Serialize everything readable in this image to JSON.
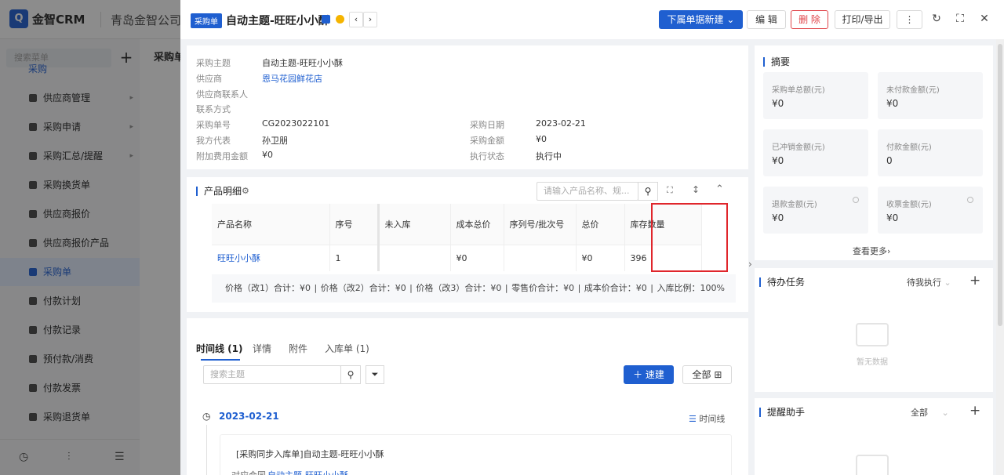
{
  "app": {
    "brand": "金智CRM",
    "company": "青岛金智公司",
    "logo_letter": "Q",
    "accent": "#1f5fd0"
  },
  "sidebar": {
    "search_placeholder": "搜索菜单",
    "add_icon": "+",
    "group_label": "采购",
    "items": [
      {
        "label": "供应商管理",
        "icon": "folder-icon",
        "has_arrow": true
      },
      {
        "label": "采购申请",
        "icon": "folder-icon",
        "has_arrow": true
      },
      {
        "label": "采购汇总/提醒",
        "icon": "folder-icon",
        "has_arrow": true
      },
      {
        "label": "采购换货单",
        "icon": "doc-icon"
      },
      {
        "label": "供应商报价",
        "icon": "doc-icon"
      },
      {
        "label": "供应商报价产品",
        "icon": "doc-icon"
      },
      {
        "label": "采购单",
        "icon": "cart-icon",
        "active": true
      },
      {
        "label": "付款计划",
        "icon": "plan-icon"
      },
      {
        "label": "付款记录",
        "icon": "record-icon"
      },
      {
        "label": "预付款/消费",
        "icon": "wallet-icon"
      },
      {
        "label": "付款发票",
        "icon": "invoice-icon"
      },
      {
        "label": "采购退货单",
        "icon": "return-icon"
      }
    ]
  },
  "background_page": {
    "title": "采购单"
  },
  "drawer": {
    "tag": "采购单",
    "title": "自动主题-旺旺小小酥",
    "buttons": {
      "new_sub": "下属单据新建",
      "edit": "编 辑",
      "delete": "删 除",
      "print": "打印/导出",
      "more": "⋮"
    },
    "info": {
      "subject_label": "采购主题",
      "subject_value": "自动主题-旺旺小小酥",
      "supplier_label": "供应商",
      "supplier_value": "恩马花园鲜花店",
      "contact_label": "供应商联系人",
      "contact_value": "",
      "contact_method_label": "联系方式",
      "contact_method_value": "",
      "order_no_label": "采购单号",
      "order_no_value": "CG2023022101",
      "rep_label": "我方代表",
      "rep_value": "孙卫朋",
      "extra_fee_label": "附加费用金额",
      "extra_fee_value": "¥0",
      "date_label": "采购日期",
      "date_value": "2023-02-21",
      "amount_label": "采购金额",
      "amount_value": "¥0",
      "status_label": "执行状态",
      "status_value": "执行中"
    },
    "products": {
      "section_title": "产品明细",
      "search_placeholder": "请输入产品名称、规...",
      "columns": [
        "产品名称",
        "序号",
        "未入库",
        "成本总价",
        "序列号/批次号",
        "总价",
        "库存数量"
      ],
      "rows": [
        {
          "name": "旺旺小小酥",
          "seq": "1",
          "not_in": "",
          "cost_total": "¥0",
          "serial": "",
          "total": "¥0",
          "stock": "396"
        }
      ],
      "summary": "价格（改1）合计：¥0 |   价格（改2）合计：¥0 |   价格（改3）合计：¥0 |   零售价合计：¥0 |   成本价合计：¥0 |   入库比例：100%"
    },
    "timeline": {
      "tabs": [
        "时间线 (1)",
        "详情",
        "附件",
        "入库单 (1)"
      ],
      "search_placeholder": "搜索主题",
      "quick_create": "速建",
      "all_label": "全部",
      "date": "2023-02-21",
      "view_label": "时间线",
      "entry_text": "[采购同步入库单]自动主题-旺旺小小酥",
      "entry_sub_label": "对应合同",
      "entry_sub_link": "自动主题-旺旺小小酥"
    }
  },
  "right_panel": {
    "summary_title": "摘要",
    "cards": [
      {
        "label": "采购单总额(元)",
        "value": "¥0"
      },
      {
        "label": "未付款金额(元)",
        "value": "¥0"
      },
      {
        "label": "已冲销金额(元)",
        "value": "¥0"
      },
      {
        "label": "付款金额(元)",
        "value": "0"
      },
      {
        "label": "退款金额(元)",
        "value": "¥0",
        "clock": true
      },
      {
        "label": "收票金额(元)",
        "value": "¥0",
        "clock": true
      }
    ],
    "see_more": "查看更多",
    "tasks_title": "待办任务",
    "tasks_filter": "待我执行",
    "empty_text": "暂无数据",
    "reminder_title": "提醒助手",
    "reminder_filter": "全部"
  }
}
